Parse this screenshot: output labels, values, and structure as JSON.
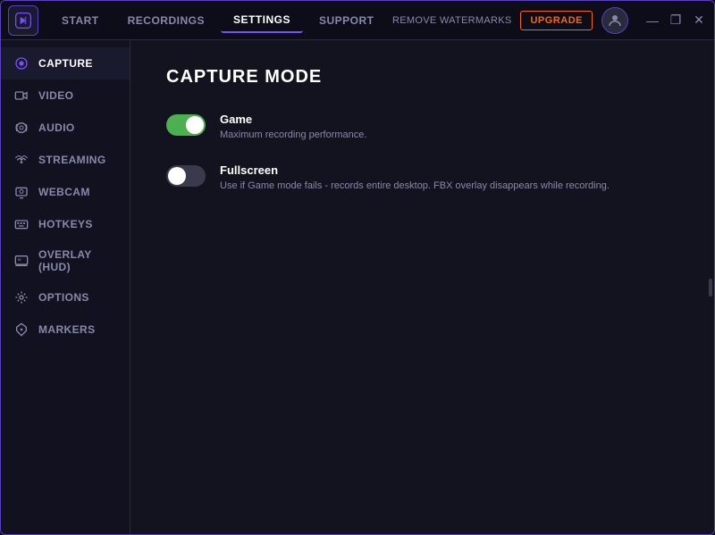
{
  "titleBar": {
    "logoAlt": "FBX Logo",
    "navTabs": [
      {
        "id": "start",
        "label": "START",
        "active": false
      },
      {
        "id": "recordings",
        "label": "RECORDINGS",
        "active": false
      },
      {
        "id": "settings",
        "label": "SETTINGS",
        "active": true
      },
      {
        "id": "support",
        "label": "SUPPORT",
        "active": false
      }
    ],
    "removeWatermarks": "REMOVE WATERMARKS",
    "upgradeLabel": "UPGRADE",
    "windowControls": {
      "minimize": "—",
      "maximize": "❐",
      "close": "✕"
    }
  },
  "sidebar": {
    "items": [
      {
        "id": "capture",
        "label": "CAPTURE",
        "icon": "●",
        "active": true
      },
      {
        "id": "video",
        "label": "VIDEO",
        "icon": "📹",
        "active": false
      },
      {
        "id": "audio",
        "label": "AUDIO",
        "icon": "🎧",
        "active": false
      },
      {
        "id": "streaming",
        "label": "STREAMING",
        "icon": "📡",
        "active": false
      },
      {
        "id": "webcam",
        "label": "WEBCAM",
        "icon": "📷",
        "active": false
      },
      {
        "id": "hotkeys",
        "label": "HOTKEYS",
        "icon": "⌨",
        "active": false
      },
      {
        "id": "overlay",
        "label": "OVERLAY (HUD)",
        "icon": "🖥",
        "active": false
      },
      {
        "id": "options",
        "label": "OPTIONS",
        "icon": "⚙",
        "active": false
      },
      {
        "id": "markers",
        "label": "MARKERS",
        "icon": "🛡",
        "active": false
      }
    ]
  },
  "content": {
    "title": "CAPTURE MODE",
    "options": [
      {
        "id": "game",
        "label": "Game",
        "description": "Maximum recording performance.",
        "enabled": true
      },
      {
        "id": "fullscreen",
        "label": "Fullscreen",
        "description": "Use if Game mode fails - records entire desktop. FBX overlay disappears while recording.",
        "enabled": false
      }
    ]
  },
  "colors": {
    "accent": "#7c4dff",
    "accentBorder": "#5a3fc0",
    "orange": "#ff6600",
    "green": "#4caf50",
    "bg": "#0d0d1a",
    "sidebar": "#111120",
    "content": "#13131f"
  }
}
